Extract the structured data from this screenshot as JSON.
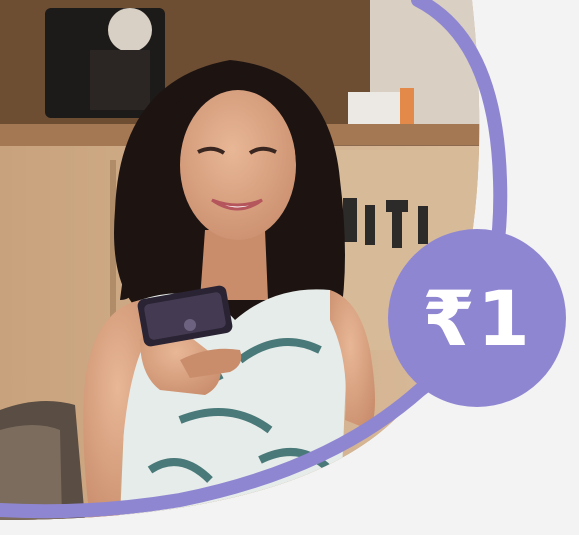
{
  "offer": {
    "price_label": "₹1"
  },
  "colors": {
    "accent_purple": "#8f86d2",
    "background": "#f3f3f3"
  }
}
